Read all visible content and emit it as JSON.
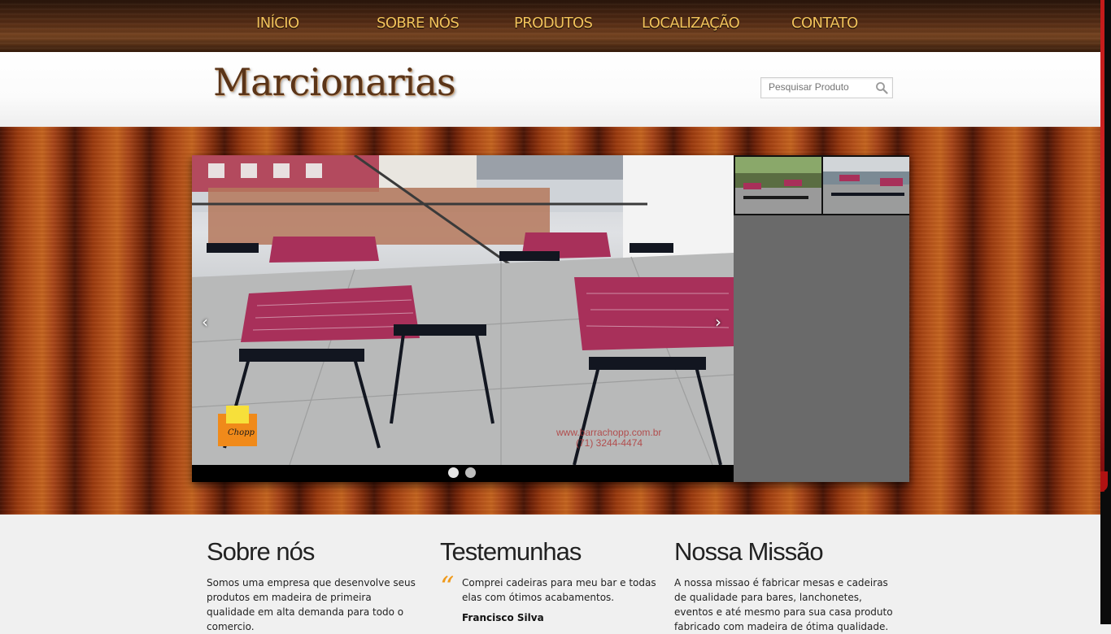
{
  "nav": {
    "items": [
      "INÍCIO",
      "SOBRE NÓS",
      "PRODUTOS",
      "LOCALIZAÇÃO",
      "CONTATO"
    ]
  },
  "header": {
    "logo_text": "Marcionarias",
    "search_placeholder": "Pesquisar Produto"
  },
  "slider": {
    "prev": "‹",
    "next": "›",
    "slides": 2,
    "active_slide": 1,
    "watermark_site": "www.barrachopp.com.br",
    "watermark_phone": "(71) 3244-4474",
    "badge_text": "Chopp"
  },
  "sections": {
    "about": {
      "title": "Sobre nós",
      "text": "Somos uma empresa que desenvolve seus produtos em madeira de primeira qualidade em alta demanda para todo o comercio."
    },
    "testimonials": {
      "title": "Testemunhas",
      "quote_mark": "“",
      "quote": "Comprei cadeiras para meu bar e todas elas com ótimos acabamentos.",
      "author": "Francisco Silva"
    },
    "mission": {
      "title": "Nossa Missão",
      "text": "A nossa missao é fabricar mesas e cadeiras de qualidade para bares, lanchonetes, eventos e até mesmo para sua casa produto fabricado com madeira de ótima qualidade."
    }
  },
  "colors": {
    "nav_text": "#f3c35b",
    "accent_quote": "#f09a1a",
    "logo": "#5a3418"
  }
}
